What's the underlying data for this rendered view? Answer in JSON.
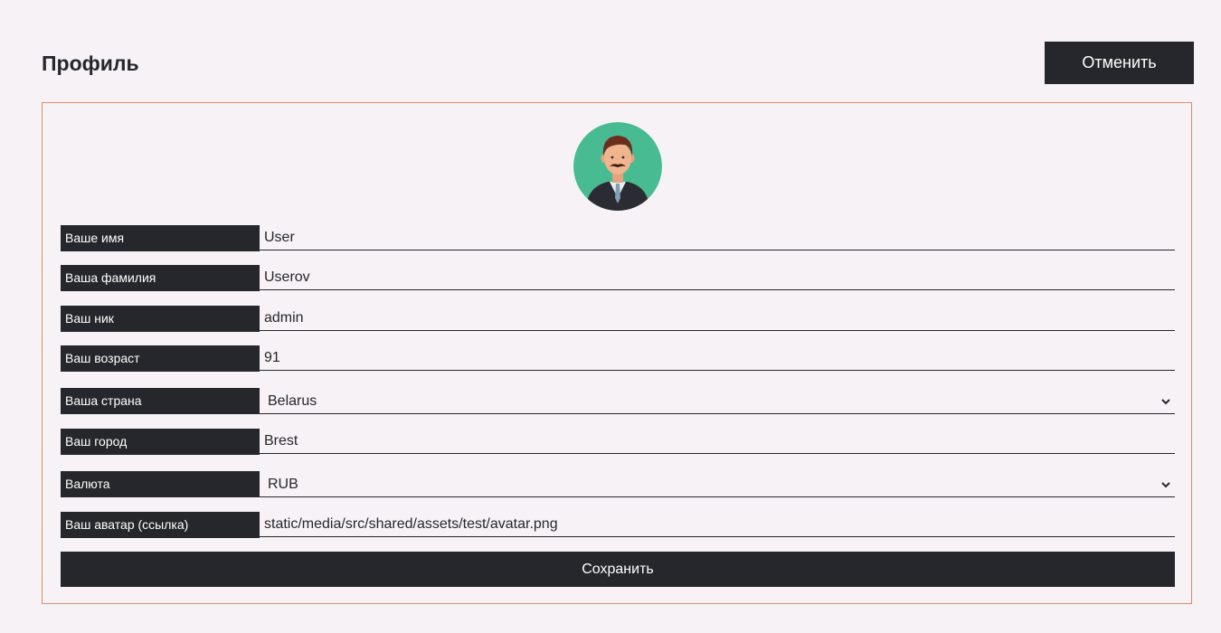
{
  "header": {
    "title": "Профиль",
    "cancel_label": "Отменить"
  },
  "profile": {
    "avatar_icon": "user-avatar-illustration",
    "fields": [
      {
        "label": "Ваше имя",
        "value": "User"
      },
      {
        "label": "Ваша фамилия",
        "value": "Userov"
      },
      {
        "label": "Ваш ник",
        "value": "admin"
      },
      {
        "label": "Ваш возраст",
        "value": "91"
      },
      {
        "label": "Ваша страна",
        "value": "Belarus"
      },
      {
        "label": "Ваш город",
        "value": "Brest"
      },
      {
        "label": "Валюта",
        "value": "RUB"
      },
      {
        "label": "Ваш аватар (ссылка)",
        "value": "static/media/src/shared/assets/test/avatar.png"
      }
    ],
    "save_label": "Сохранить"
  },
  "colors": {
    "background": "#f6f2f6",
    "dark": "#26272c",
    "card_border": "#d98e6a",
    "avatar_bg": "#48bb92"
  }
}
